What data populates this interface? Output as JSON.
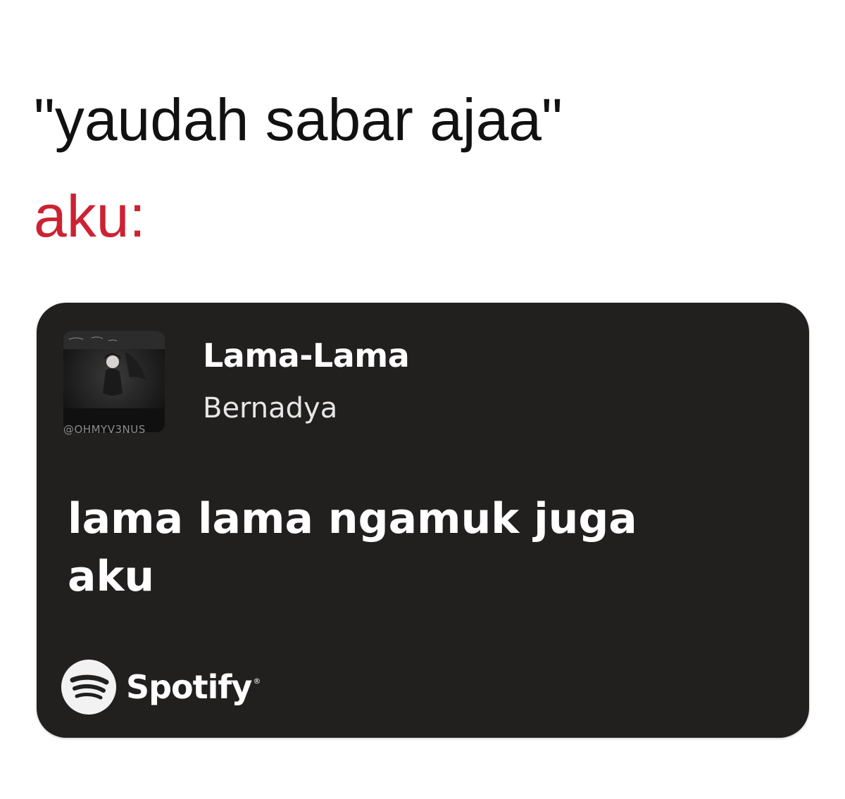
{
  "caption": {
    "line1": "\"yaudah sabar ajaa\"",
    "line2": "aku:",
    "line2_color": "#cc2233"
  },
  "share_card": {
    "background_color": "#221f1f",
    "cover_icon": "album-cover-art",
    "watermark": "@OHMYV3NUS",
    "track_title": "Lama-Lama",
    "artist": "Bernadya",
    "lyrics": [
      "lama lama ngamuk juga",
      "aku"
    ],
    "brand": {
      "icon": "spotify-logo-icon",
      "name": "Spotify",
      "trademark": "®"
    }
  }
}
